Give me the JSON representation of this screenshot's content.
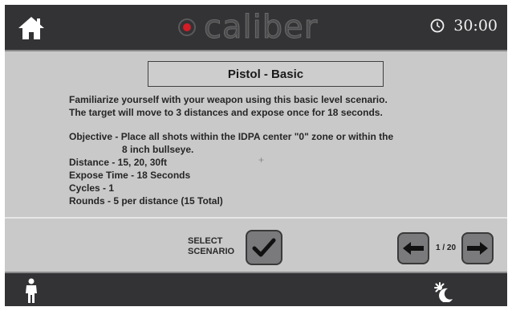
{
  "header": {
    "home_icon": "home-icon",
    "logo_text": "caliber",
    "timer_icon": "clock-icon",
    "timer": "30:00"
  },
  "scenario": {
    "title": "Pistol - Basic",
    "intro": [
      "Familiarize yourself with your weapon using this basic level scenario.",
      "The target will move to 3 distances and expose once for 18 seconds."
    ],
    "objective": "Objective - Place all shots within the IDPA center \"0\" zone or within the",
    "objective_cont": "8 inch bullseye.",
    "distance": "Distance  - 15, 20, 30ft",
    "expose_time": "Expose Time - 18 Seconds",
    "cycles": "Cycles - 1",
    "rounds": "Rounds - 5 per distance (15 Total)"
  },
  "footer": {
    "select_label_line1": "SELECT",
    "select_label_line2": "SCENARIO",
    "select_icon": "checkmark-icon",
    "prev_icon": "arrow-left-icon",
    "next_icon": "arrow-right-icon",
    "page": "1 / 20"
  },
  "bottom": {
    "person_icon": "person-icon",
    "day_night_icon": "day-night-icon"
  },
  "colors": {
    "bar": "#333336",
    "panel": "#c9c9c9",
    "logo_accent": "#d21d26",
    "button": "#7a7a7c"
  }
}
